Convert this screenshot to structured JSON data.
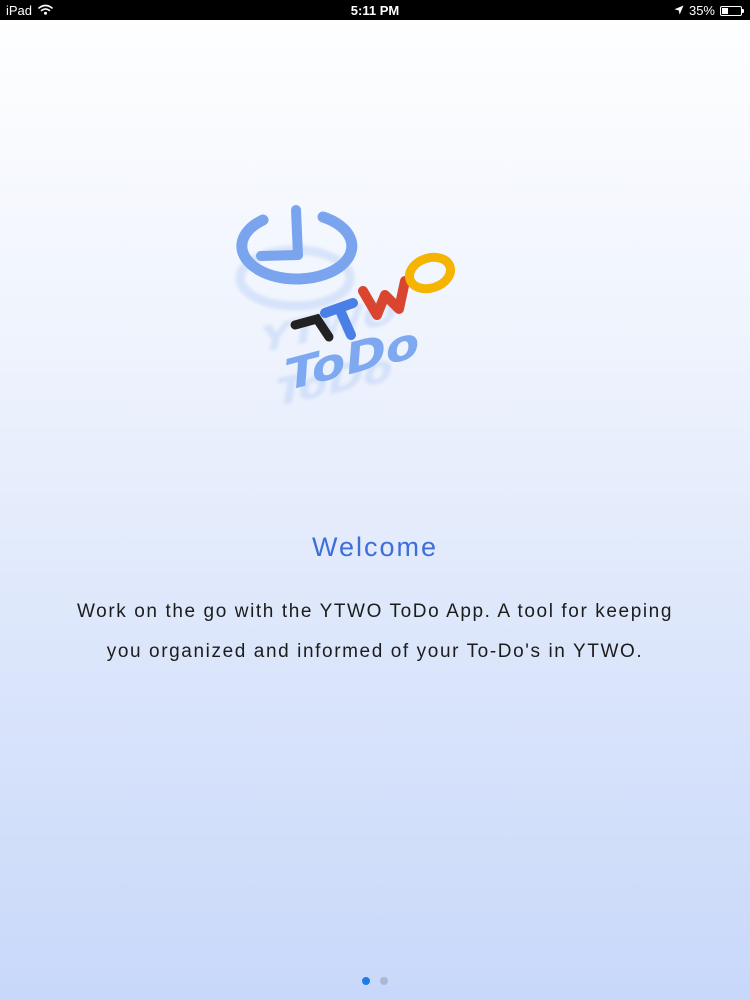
{
  "status_bar": {
    "device": "iPad",
    "time": "5:11 PM",
    "battery_text": "35%",
    "battery_level": 0.35,
    "icons": [
      "wifi-icon",
      "location-arrow-icon",
      "battery-icon"
    ]
  },
  "logo": {
    "name": "YTWO ToDo logo",
    "line1": "YTWO",
    "line2": "ToDo",
    "colors": {
      "clock": "#7aa5ee",
      "y": "#222222",
      "t": "#4a7fe5",
      "w": "#d9452f",
      "o": "#f4b400",
      "todo": "#7ea8ef"
    }
  },
  "onboarding": {
    "title": "Welcome",
    "line1": "Work on the go with the YTWO ToDo App. A tool for keeping",
    "line2": "you organized and informed of your To-Do's in YTWO."
  },
  "pager": {
    "page_count": 2,
    "active_index": 0,
    "active_color": "#1e7bea",
    "inactive_color": "#a9b7d2"
  },
  "theme": {
    "accent": "#3e6fd8",
    "text": "#1c1c1c"
  }
}
